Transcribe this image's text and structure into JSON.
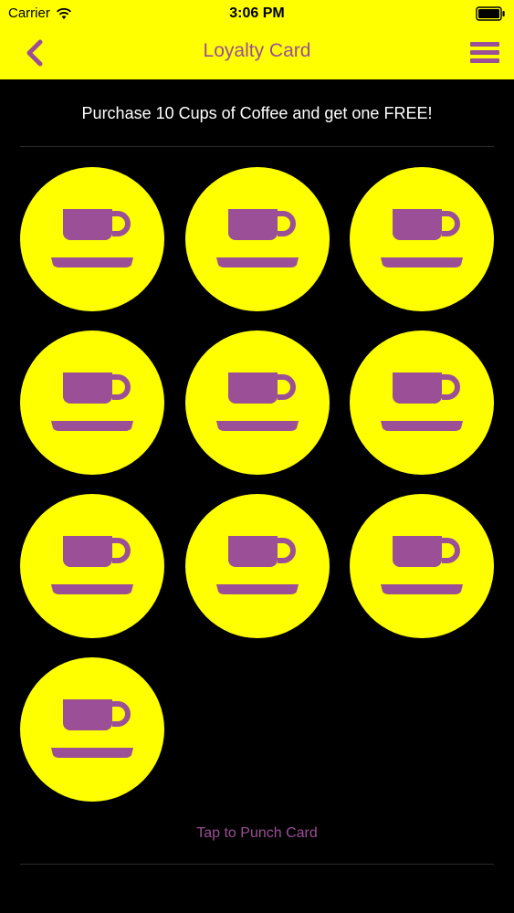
{
  "status_bar": {
    "carrier": "Carrier",
    "time": "3:06 PM",
    "wifi_icon": "wifi-icon",
    "battery_icon": "battery-icon"
  },
  "nav": {
    "title": "Loyalty Card",
    "back_icon": "chevron-left-icon",
    "menu_icon": "hamburger-menu-icon"
  },
  "card": {
    "promo": "Purchase 10 Cups of Coffee and get one FREE!",
    "stamp_icon": "coffee-cup-icon",
    "stamps_total": 10,
    "punch_label": "Tap to Punch Card"
  },
  "colors": {
    "accent": "#ffff00",
    "brand": "#9b4f96",
    "background": "#000000"
  }
}
